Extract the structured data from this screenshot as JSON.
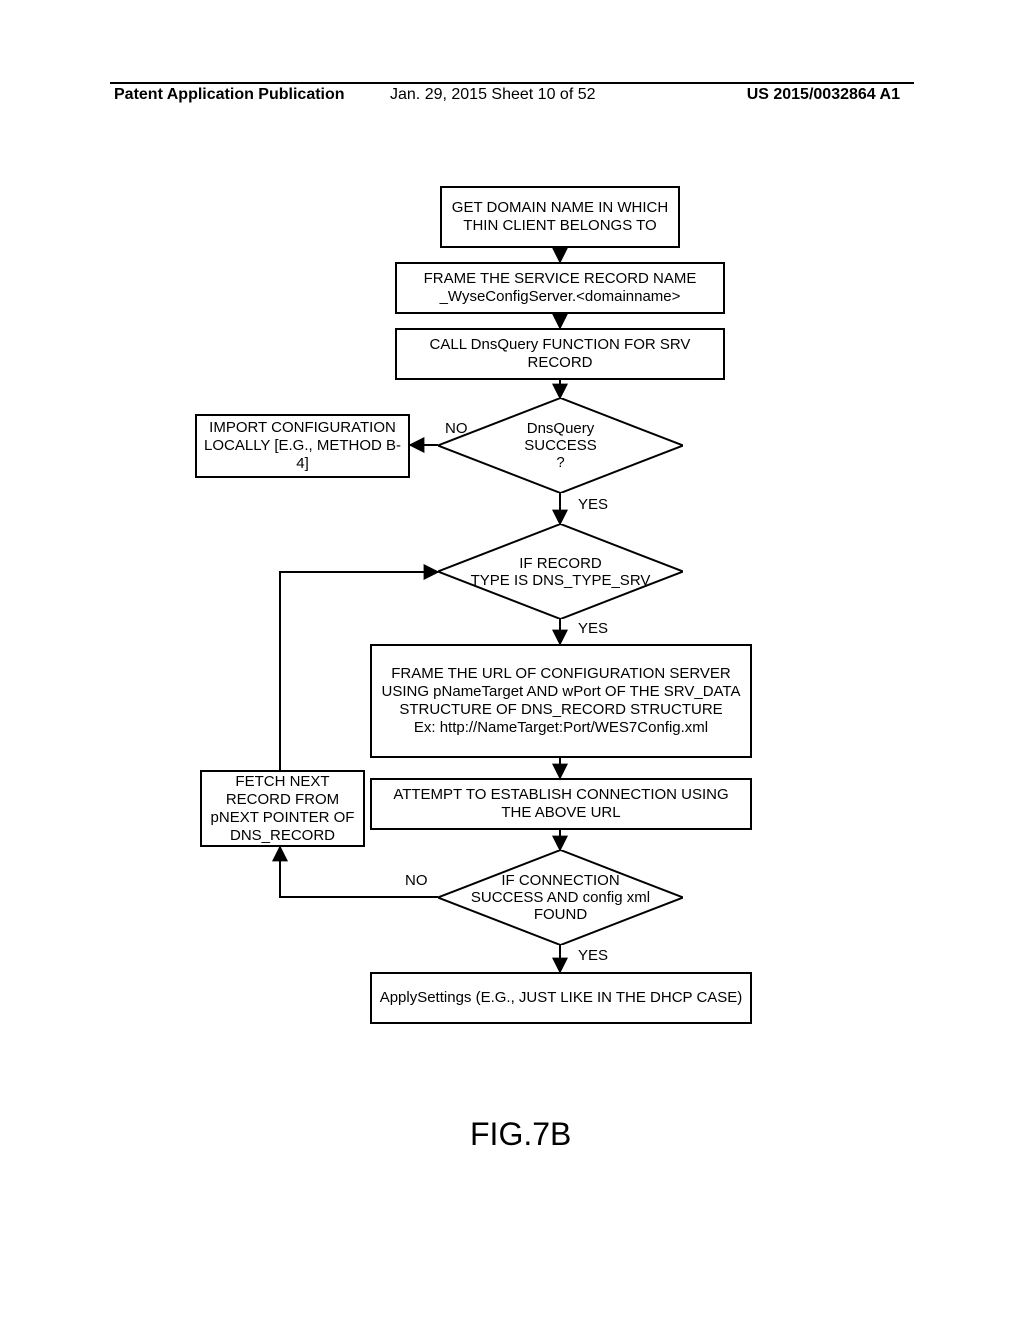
{
  "header": {
    "left": "Patent Application Publication",
    "mid": "Jan. 29, 2015  Sheet 10 of 52",
    "right": "US 2015/0032864 A1"
  },
  "boxes": {
    "b1": "GET DOMAIN NAME IN WHICH THIN CLIENT BELONGS TO",
    "b2": "FRAME THE SERVICE RECORD NAME _WyseConfigServer.<domainname>",
    "b3": "CALL DnsQuery FUNCTION FOR SRV RECORD",
    "b4": "IMPORT CONFIGURATION LOCALLY [E.G., METHOD B-4]",
    "b5": "FRAME THE URL OF CONFIGURATION SERVER USING pNameTarget AND wPort OF THE SRV_DATA STRUCTURE OF DNS_RECORD STRUCTURE\nEx: http://NameTarget:Port/WES7Config.xml",
    "b6": "ATTEMPT TO ESTABLISH CONNECTION USING THE ABOVE URL",
    "b7": "FETCH NEXT RECORD FROM pNEXT POINTER OF DNS_RECORD",
    "b8": "ApplySettings (E.G., JUST LIKE IN THE DHCP CASE)"
  },
  "diamonds": {
    "d1": "DnsQuery\nSUCCESS\n?",
    "d2": "IF RECORD\nTYPE IS DNS_TYPE_SRV",
    "d3": "IF CONNECTION\nSUCCESS AND config xml\nFOUND"
  },
  "labels": {
    "yes": "YES",
    "no": "NO"
  },
  "figure": "FIG.7B",
  "chart_data": {
    "type": "flowchart",
    "nodes": [
      {
        "id": "b1",
        "shape": "rect",
        "text": "GET DOMAIN NAME IN WHICH THIN CLIENT BELONGS TO"
      },
      {
        "id": "b2",
        "shape": "rect",
        "text": "FRAME THE SERVICE RECORD NAME _WyseConfigServer.<domainname>"
      },
      {
        "id": "b3",
        "shape": "rect",
        "text": "CALL DnsQuery FUNCTION FOR SRV RECORD"
      },
      {
        "id": "d1",
        "shape": "diamond",
        "text": "DnsQuery SUCCESS ?"
      },
      {
        "id": "b4",
        "shape": "rect",
        "text": "IMPORT CONFIGURATION LOCALLY [E.G., METHOD B-4]"
      },
      {
        "id": "d2",
        "shape": "diamond",
        "text": "IF RECORD TYPE IS DNS_TYPE_SRV"
      },
      {
        "id": "b5",
        "shape": "rect",
        "text": "FRAME THE URL OF CONFIGURATION SERVER USING pNameTarget AND wPort OF THE SRV_DATA STRUCTURE OF DNS_RECORD STRUCTURE Ex: http://NameTarget:Port/WES7Config.xml"
      },
      {
        "id": "b6",
        "shape": "rect",
        "text": "ATTEMPT TO ESTABLISH CONNECTION USING THE ABOVE URL"
      },
      {
        "id": "d3",
        "shape": "diamond",
        "text": "IF CONNECTION SUCCESS AND config xml FOUND"
      },
      {
        "id": "b7",
        "shape": "rect",
        "text": "FETCH NEXT RECORD FROM pNEXT POINTER OF DNS_RECORD"
      },
      {
        "id": "b8",
        "shape": "rect",
        "text": "ApplySettings (E.G., JUST LIKE IN THE DHCP CASE)"
      }
    ],
    "edges": [
      {
        "from": "b1",
        "to": "b2"
      },
      {
        "from": "b2",
        "to": "b3"
      },
      {
        "from": "b3",
        "to": "d1"
      },
      {
        "from": "d1",
        "to": "b4",
        "label": "NO"
      },
      {
        "from": "d1",
        "to": "d2",
        "label": "YES"
      },
      {
        "from": "d2",
        "to": "b5",
        "label": "YES"
      },
      {
        "from": "b5",
        "to": "b6"
      },
      {
        "from": "b6",
        "to": "d3"
      },
      {
        "from": "d3",
        "to": "b7",
        "label": "NO"
      },
      {
        "from": "b7",
        "to": "d2"
      },
      {
        "from": "d3",
        "to": "b8",
        "label": "YES"
      }
    ]
  }
}
